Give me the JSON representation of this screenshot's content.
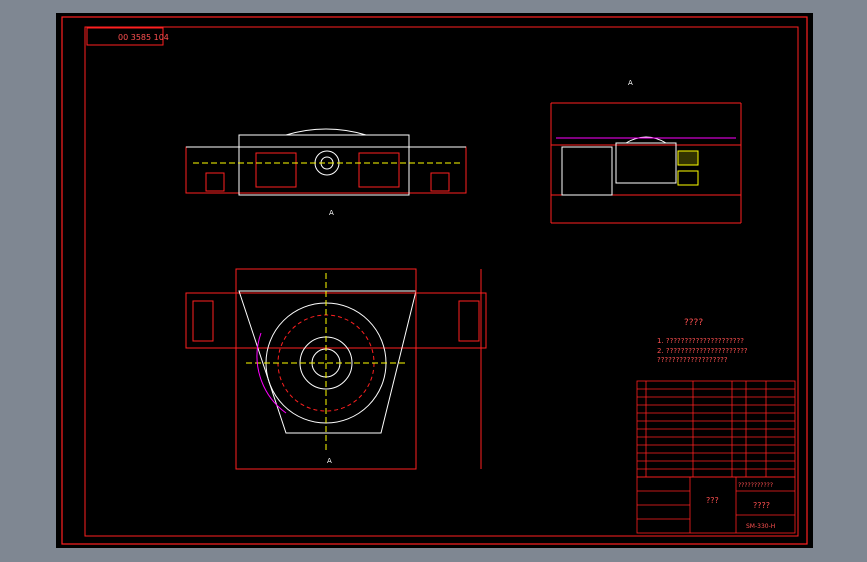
{
  "drawing": {
    "top_left_label": "00 3585 104",
    "section_label_top": "A",
    "section_mark_bottom": "A",
    "technical_requirements": {
      "title": "????",
      "line1": "1. ?????????????????????",
      "line2": "2. ??????????????????????",
      "line3": "   ???????????????????"
    },
    "title_block": {
      "drawing_title": "????",
      "name_cell": "???",
      "company": "???????????",
      "drawing_number": "SM-330-H"
    },
    "colors": {
      "background": "#000000",
      "frame": "#ff0000",
      "lines": "#ffffff",
      "dims": "#ff0000",
      "accent": "#ff00ff",
      "highlight": "#ffff00"
    }
  }
}
